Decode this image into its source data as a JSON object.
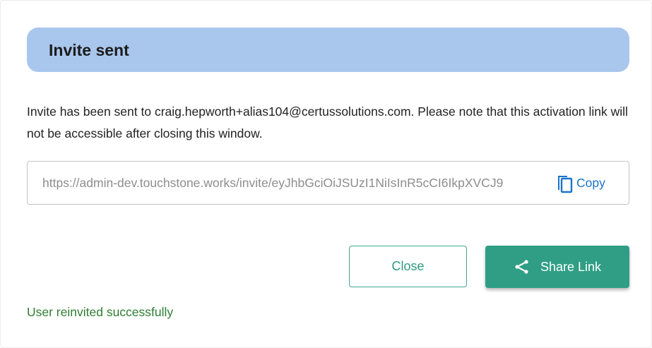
{
  "dialog": {
    "title": "Invite sent",
    "message": "Invite has been sent to craig.hepworth+alias104@certussolutions.com. Please note that this activation link will not be accessible after closing this window.",
    "link": {
      "value": "https://admin-dev.touchstone.works/invite/eyJhbGciOiJSUzI1NiIsInR5cCI6IkpXVCJ9",
      "copy_label": "Copy",
      "copy_icon": "copy-icon"
    },
    "buttons": {
      "close_label": "Close",
      "share_label": "Share Link",
      "share_icon": "share-icon"
    },
    "status": "User reinvited successfully"
  },
  "colors": {
    "header_bg": "#a9c6ed",
    "primary": "#2f9e85",
    "link_blue": "#1a73c9",
    "success": "#2e7d32"
  }
}
